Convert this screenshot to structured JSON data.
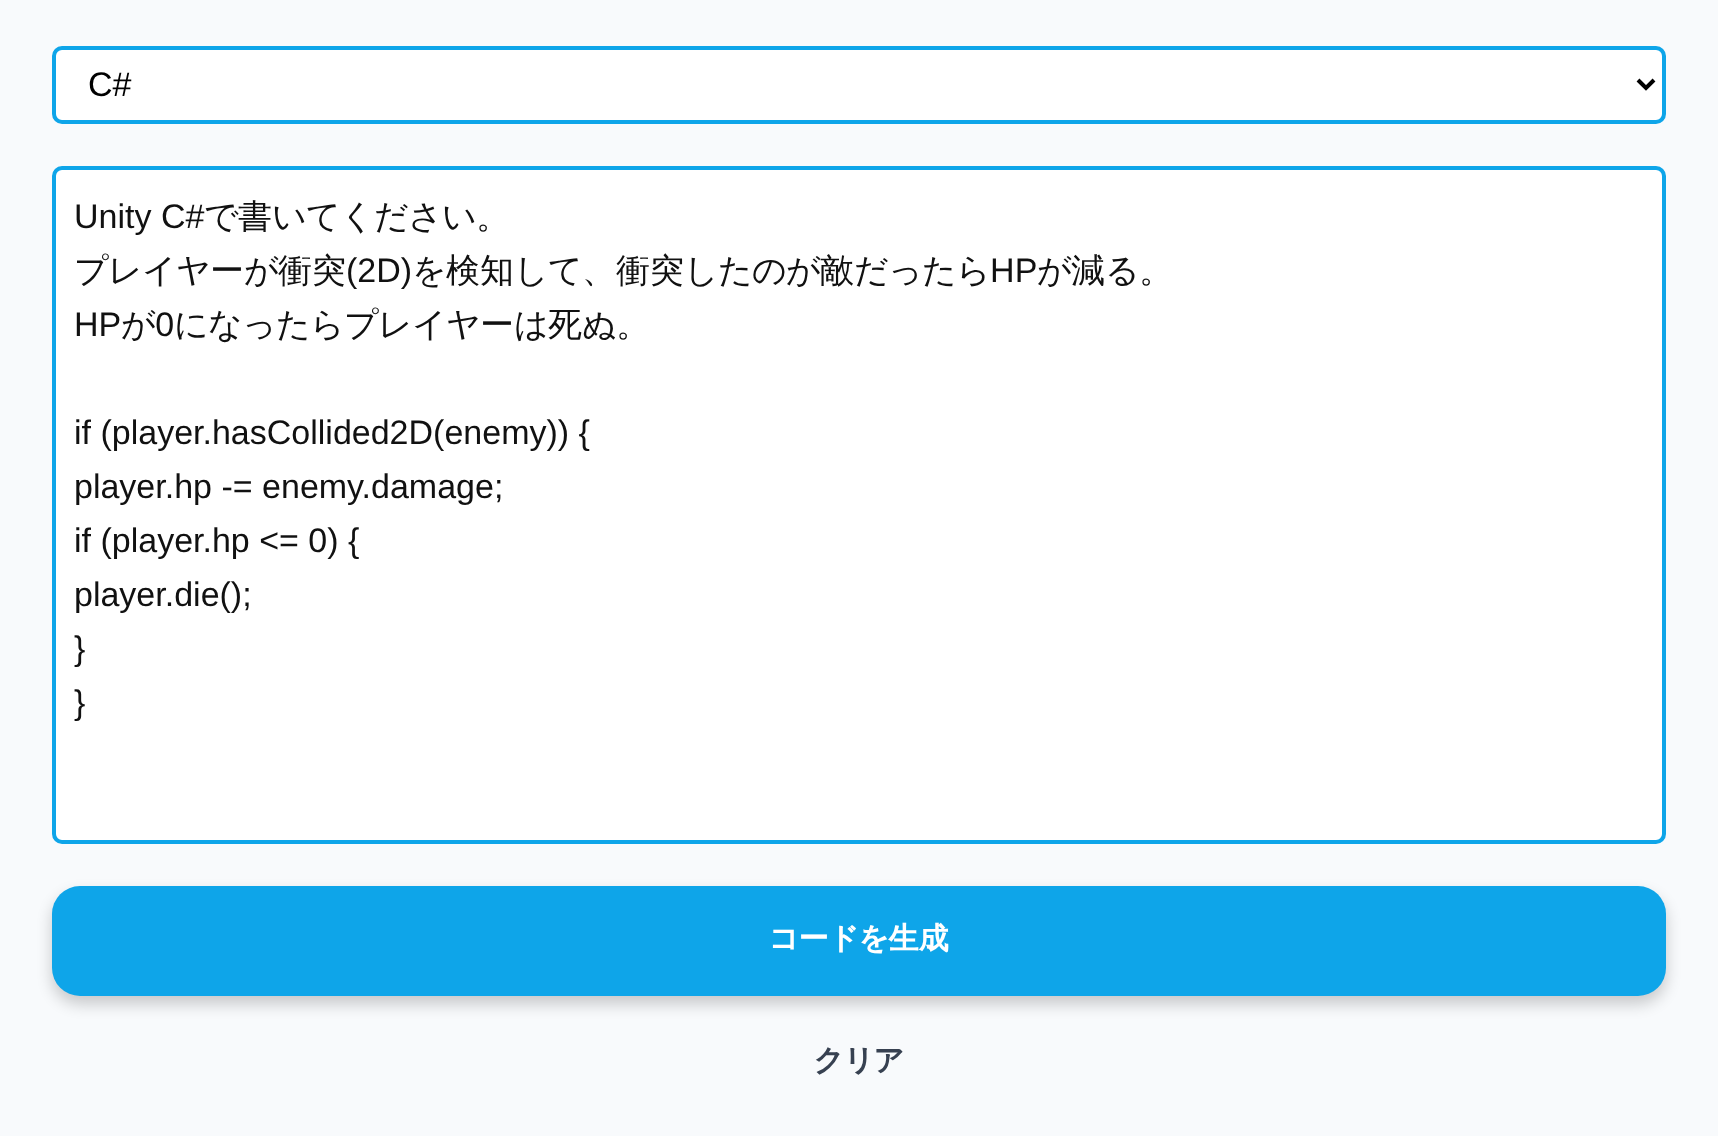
{
  "language_select": {
    "value": "C#"
  },
  "prompt": {
    "text_lines": [
      "Unity C#で書いてください。",
      "プレイヤーが衝突(2D)を検知して、衝突したのが敵だったらHPが減る。",
      "HPが0になったらプレイヤーは死ぬ。"
    ],
    "code_lines": [
      "if (player.hasCollided2D(enemy)) {",
      "player.hp -= enemy.damage;",
      "if (player.hp <= 0) {",
      "player.die();",
      "}",
      "}"
    ]
  },
  "generate_button": {
    "label": "コードを生成"
  },
  "clear_button": {
    "label": "クリア"
  }
}
